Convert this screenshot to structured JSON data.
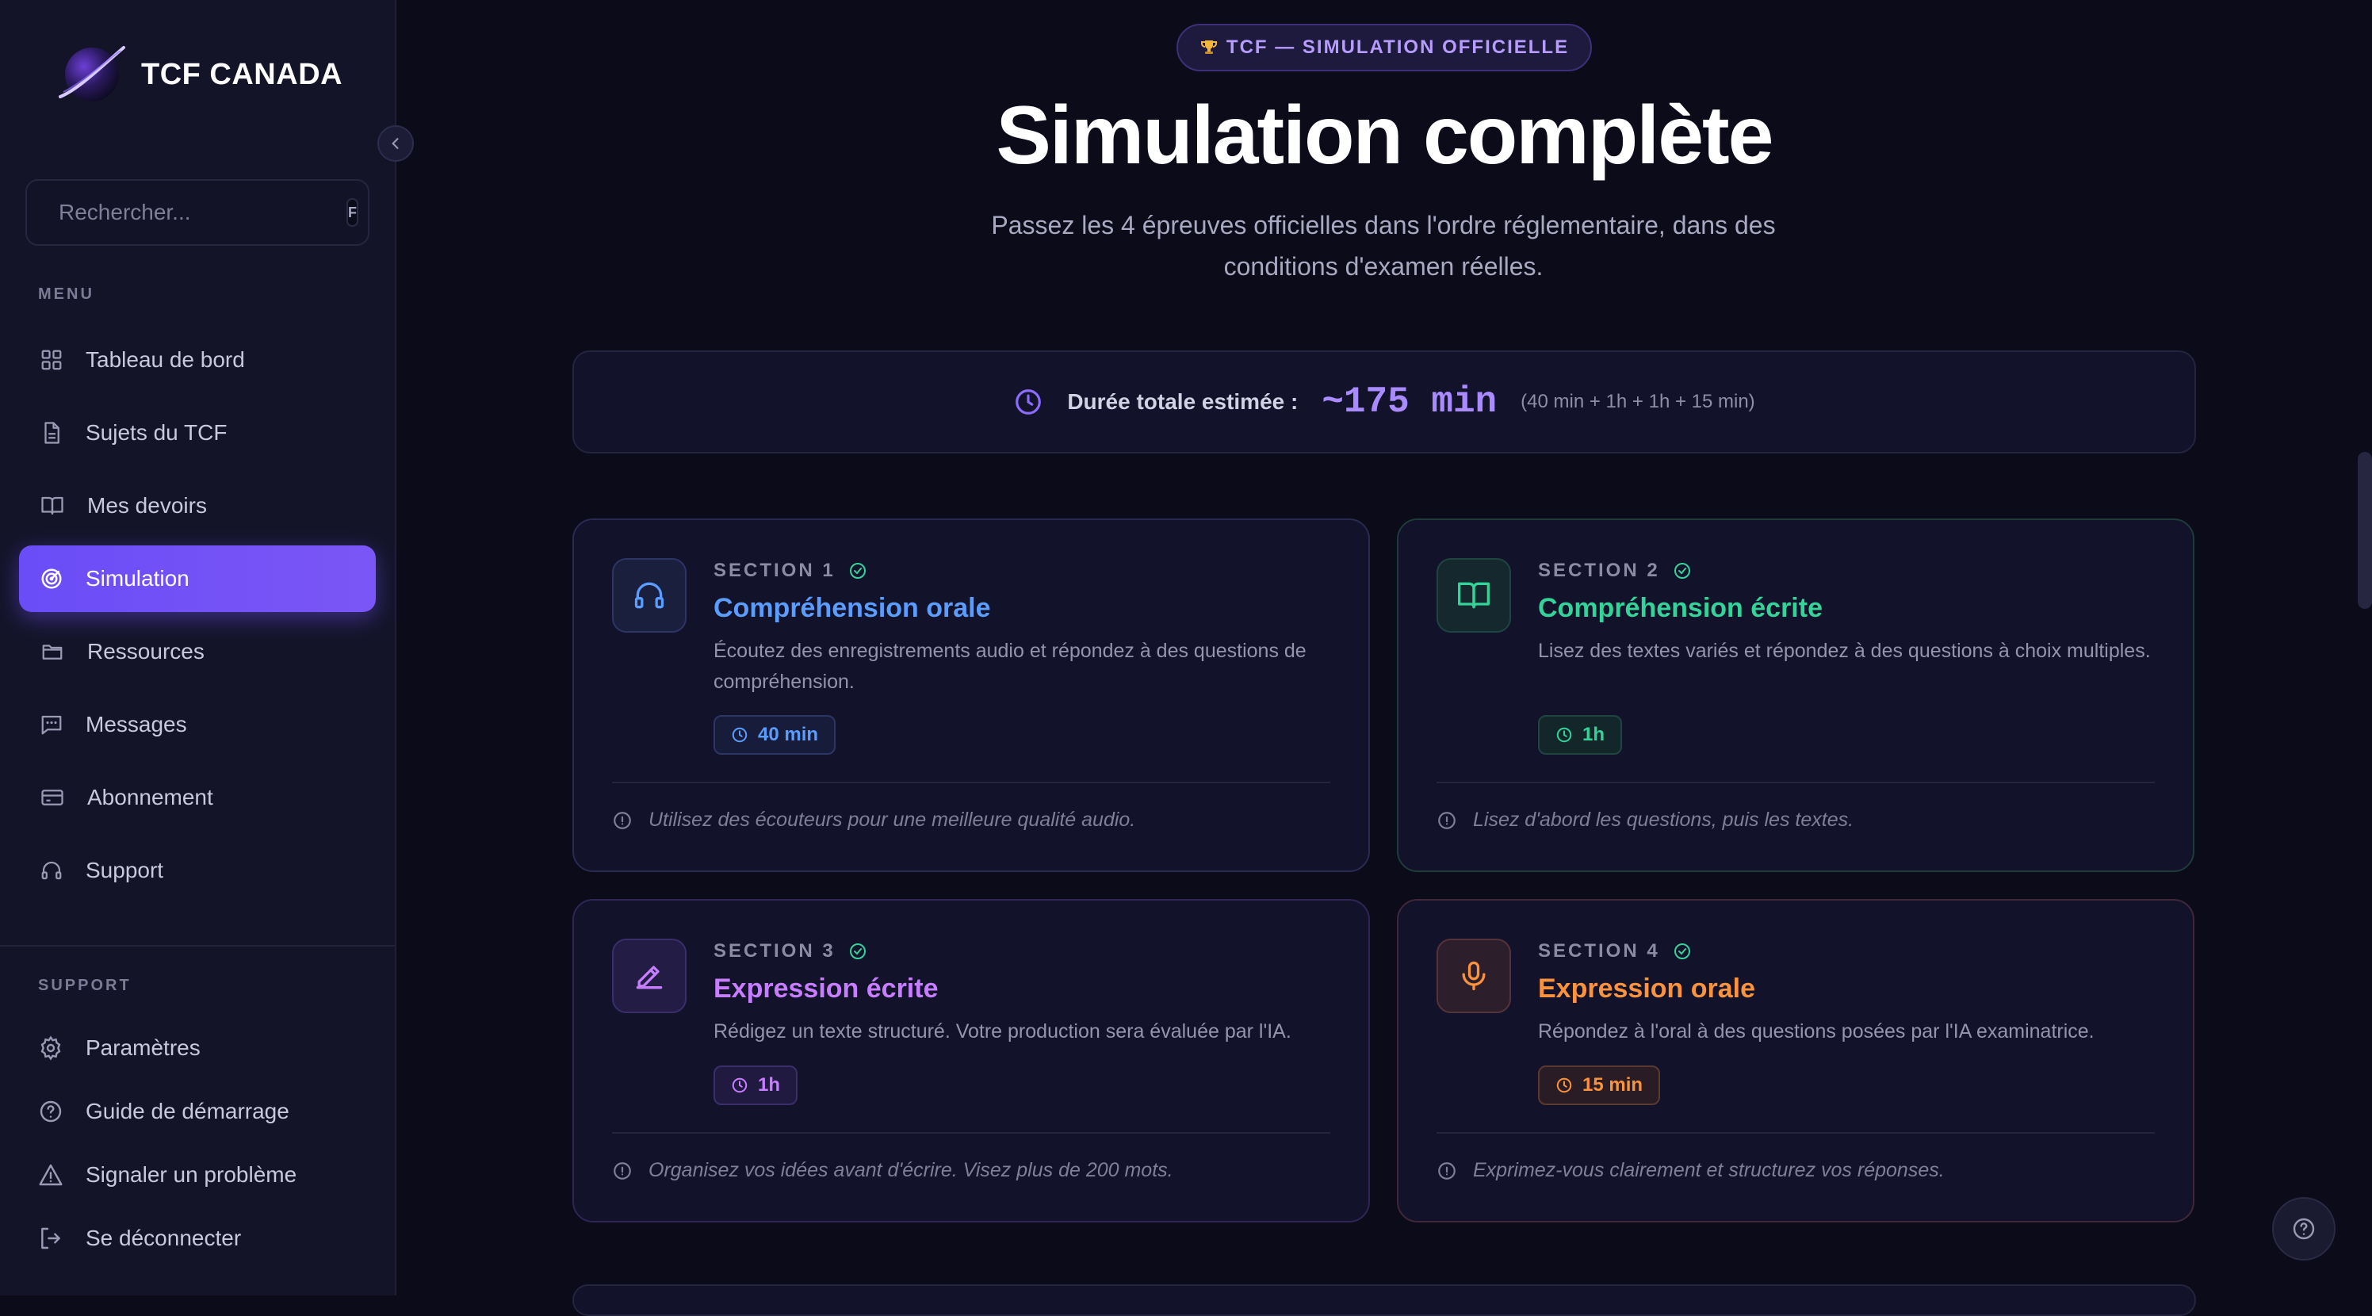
{
  "sidebar": {
    "brand": "TCF CANADA",
    "search": {
      "placeholder": "Rechercher...",
      "shortcut": "F"
    },
    "menu_label": "MENU",
    "menu": [
      {
        "label": "Tableau de bord",
        "icon": "grid-icon"
      },
      {
        "label": "Sujets du TCF",
        "icon": "document-icon"
      },
      {
        "label": "Mes devoirs",
        "icon": "book-icon"
      },
      {
        "label": "Simulation",
        "icon": "target-icon",
        "active": true
      },
      {
        "label": "Ressources",
        "icon": "folder-icon"
      },
      {
        "label": "Messages",
        "icon": "message-icon"
      },
      {
        "label": "Abonnement",
        "icon": "credit-card-icon"
      },
      {
        "label": "Support",
        "icon": "headset-icon"
      }
    ],
    "support_label": "SUPPORT",
    "support": [
      {
        "label": "Paramètres",
        "icon": "gear-icon"
      },
      {
        "label": "Guide de démarrage",
        "icon": "help-circle-icon"
      },
      {
        "label": "Signaler un problème",
        "icon": "warning-icon"
      },
      {
        "label": "Se déconnecter",
        "icon": "logout-icon"
      }
    ]
  },
  "main": {
    "badge": "TCF — SIMULATION OFFICIELLE",
    "title": "Simulation complète",
    "subtitle": "Passez les 4 épreuves officielles dans l'ordre réglementaire, dans des conditions d'examen réelles.",
    "duration": {
      "label": "Durée totale estimée :",
      "value": "~175 min",
      "detail": "(40 min + 1h + 1h + 15 min)"
    },
    "sections": [
      {
        "section": "SECTION 1",
        "name": "Compréhension orale",
        "description": "Écoutez des enregistrements audio et répondez à des questions de compréhension.",
        "time": "40 min",
        "tip": "Utilisez des écouteurs pour une meilleure qualité audio.",
        "icon": "headphones-icon",
        "color": "#5b9cff"
      },
      {
        "section": "SECTION 2",
        "name": "Compréhension écrite",
        "description": "Lisez des textes variés et répondez à des questions à choix multiples.",
        "time": "1h",
        "tip": "Lisez d'abord les questions, puis les textes.",
        "icon": "open-book-icon",
        "color": "#34d399"
      },
      {
        "section": "SECTION 3",
        "name": "Expression écrite",
        "description": "Rédigez un texte structuré. Votre production sera évaluée par l'IA.",
        "time": "1h",
        "tip": "Organisez vos idées avant d'écrire. Visez plus de 200 mots.",
        "icon": "pencil-icon",
        "color": "#c77dff"
      },
      {
        "section": "SECTION 4",
        "name": "Expression orale",
        "description": "Répondez à l'oral à des questions posées par l'IA examinatrice.",
        "time": "15 min",
        "tip": "Exprimez-vous clairement et structurez vos réponses.",
        "icon": "microphone-icon",
        "color": "#fb923c"
      }
    ]
  }
}
